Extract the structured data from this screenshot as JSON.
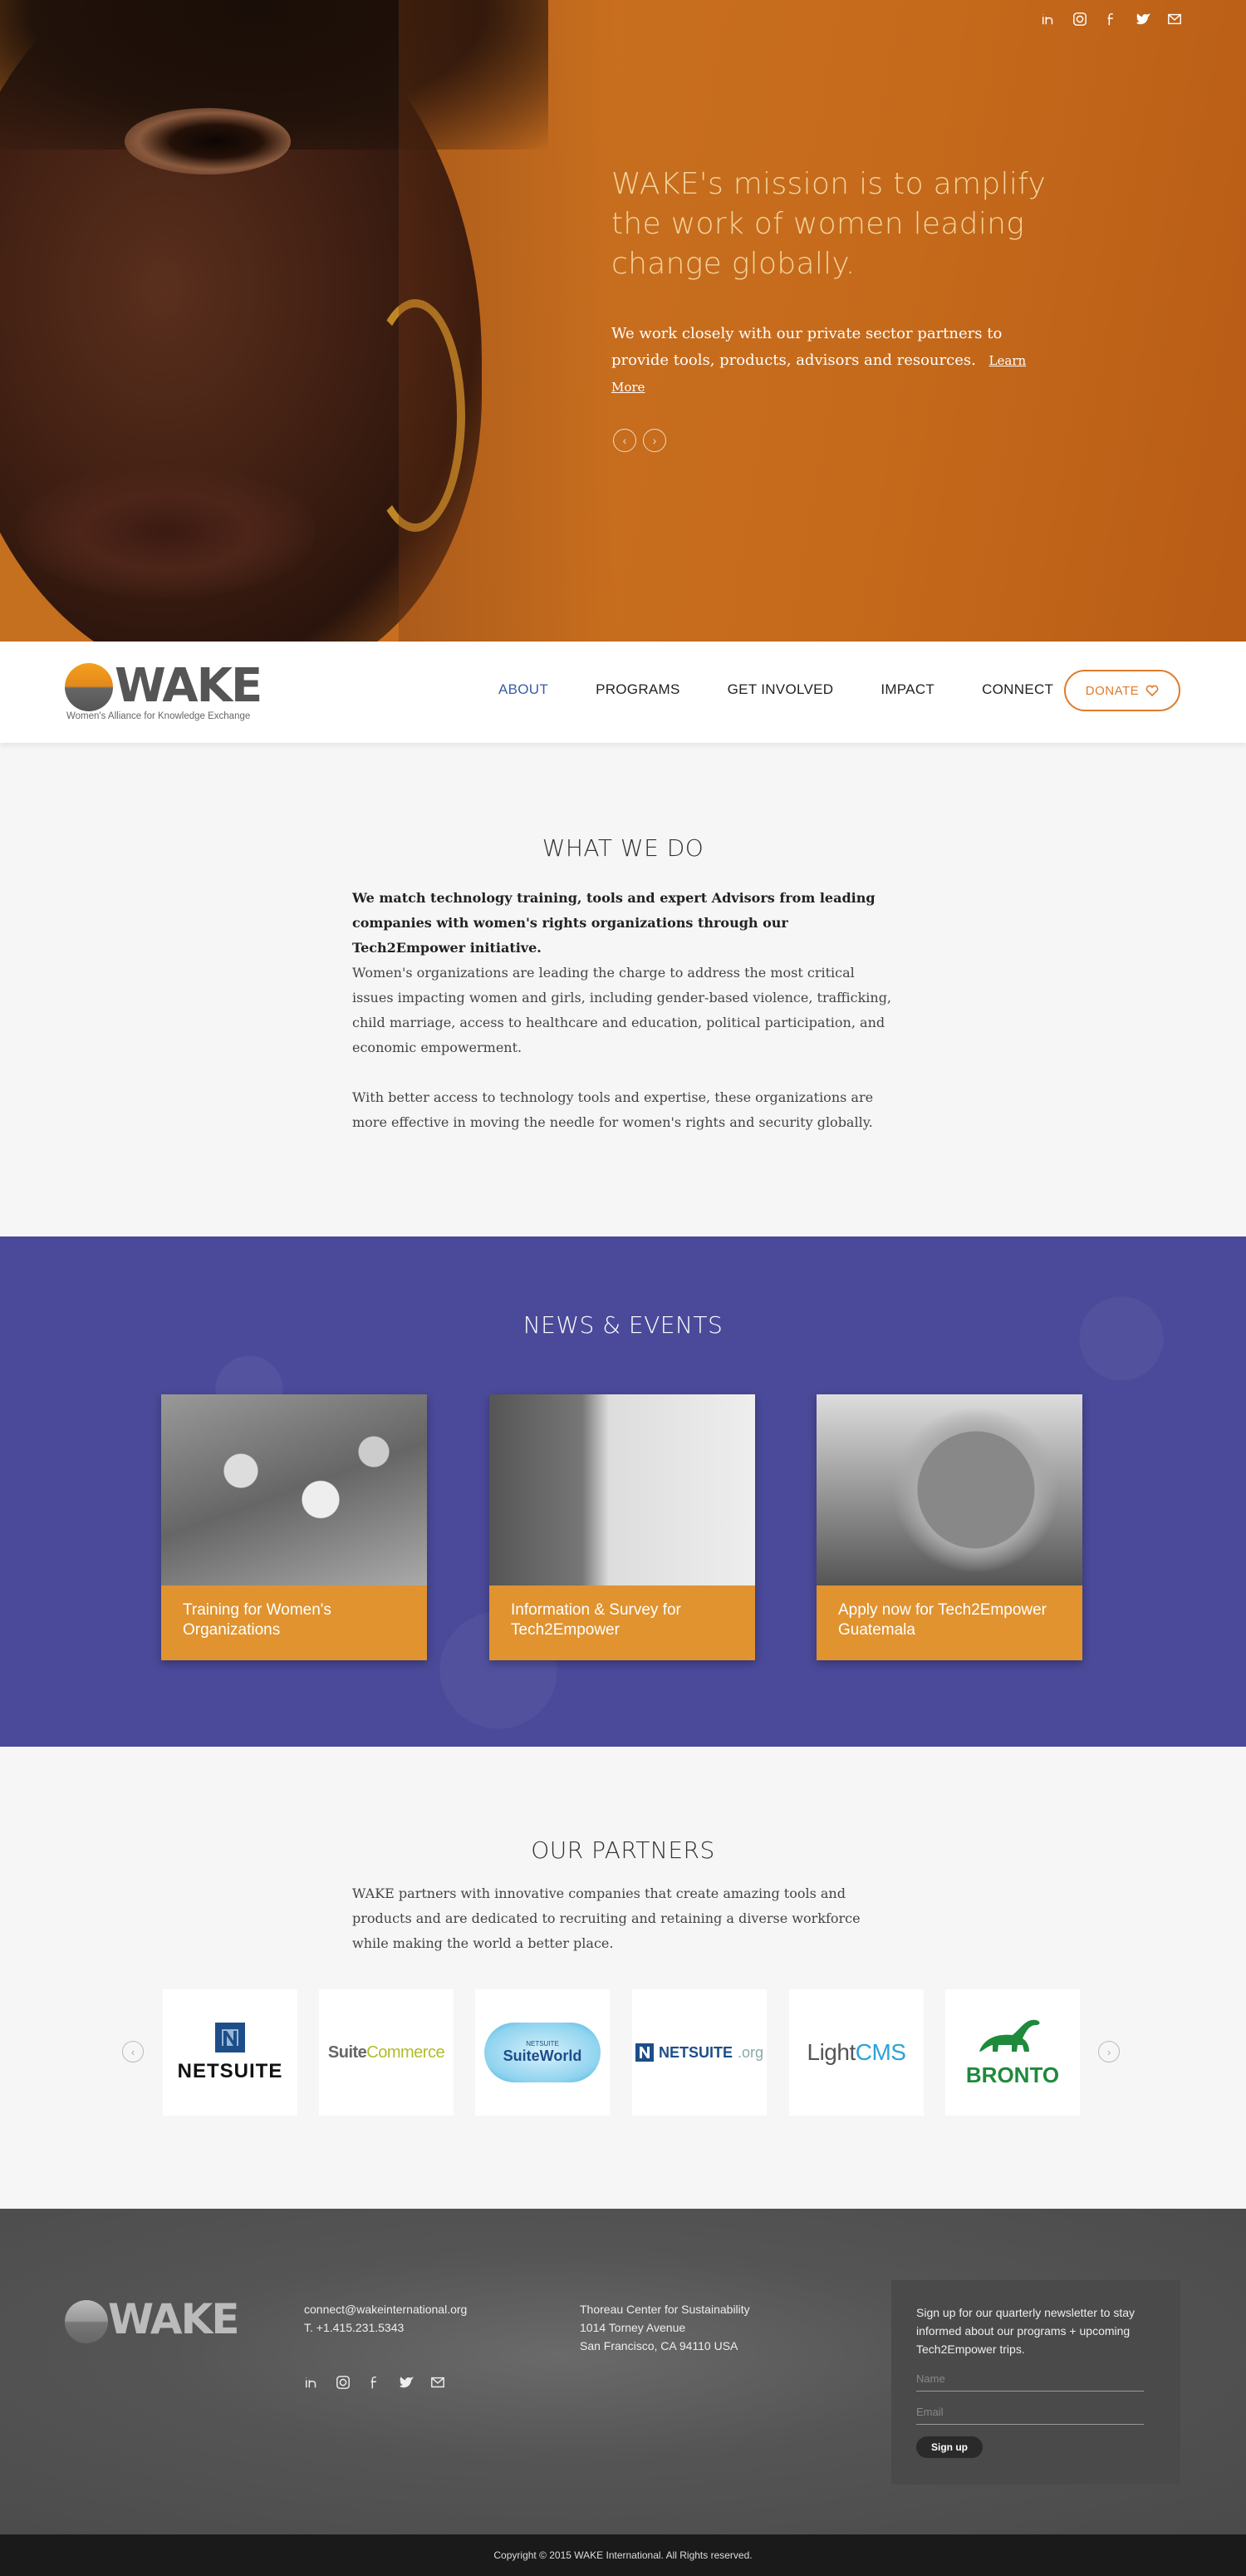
{
  "hero": {
    "title": "WAKE's mission is to amplify the work of women leading change globally.",
    "text": "We work closely with our private sector partners to provide tools, products, advisors and resources.",
    "link": "Learn More",
    "social_icons": [
      "linkedin-icon",
      "instagram-icon",
      "facebook-icon",
      "twitter-icon",
      "mail-icon"
    ],
    "prev": "‹",
    "next": "›"
  },
  "nav": {
    "logo_word": "WAKE",
    "logo_subtitle": "Women's Alliance for Knowledge Exchange",
    "items": [
      {
        "label": "ABOUT",
        "active": true
      },
      {
        "label": "PROGRAMS",
        "active": false
      },
      {
        "label": "GET INVOLVED",
        "active": false
      },
      {
        "label": "IMPACT",
        "active": false
      },
      {
        "label": "CONNECT",
        "active": false
      }
    ],
    "donate": "DONATE",
    "active_color": "#3b5ba7",
    "accent_color": "#e07b2a"
  },
  "what_we_do": {
    "title": "WHAT WE DO",
    "lead": "We match technology training, tools and expert Advisors from leading companies with women's rights organizations through our Tech2Empower initiative.",
    "p1": "Women's organizations are leading the charge to address the most critical issues impacting women and girls, including gender-based violence, trafficking, child marriage, access to healthcare and education, political participation, and economic empowerment.",
    "p2": "With better access to technology tools and expertise, these organizations are more effective in moving the needle for women's rights and security globally."
  },
  "news": {
    "title": "NEWS & EVENTS",
    "cards": [
      {
        "caption": "Training for Women's Organizations"
      },
      {
        "caption": "Information & Survey for Tech2Empower"
      },
      {
        "caption": "Apply now for Tech2Empower Guatemala"
      }
    ],
    "bg_color": "#4b4a9a",
    "caption_color": "#e0932f"
  },
  "partners": {
    "title": "OUR PARTNERS",
    "text": "WAKE partners with innovative companies that create amazing tools and products and are dedicated to recruiting and retaining a diverse workforce while making the world a better place.",
    "logos": [
      {
        "name": "NETSUITE"
      },
      {
        "name": "SuiteCommerce",
        "part1": "Suite",
        "part2": "Commerce"
      },
      {
        "name": "SuiteWorld",
        "small": "NETSUITE"
      },
      {
        "name": "NETSUITE.org",
        "word": "NETSUITE",
        "suffix": ".org"
      },
      {
        "name": "LightCMS",
        "part1": "Light",
        "part2": "CMS"
      },
      {
        "name": "BRONTO"
      }
    ],
    "prev": "‹",
    "next": "›"
  },
  "footer": {
    "logo_word": "WAKE",
    "email": "connect@wakeinternational.org",
    "phone": "T. +1.415.231.5343",
    "address_name": "Thoreau Center for Sustainability",
    "address_street": "1014 Torney Avenue",
    "address_city": "San Francisco, CA 94110 USA",
    "newsletter_text": "Sign up for our quarterly newsletter to stay informed about our programs + upcoming Tech2Empower trips.",
    "name_placeholder": "Name",
    "email_placeholder": "Email",
    "signup": "Sign up",
    "copyright": "Copyright © 2015 WAKE International. All Rights reserved."
  }
}
